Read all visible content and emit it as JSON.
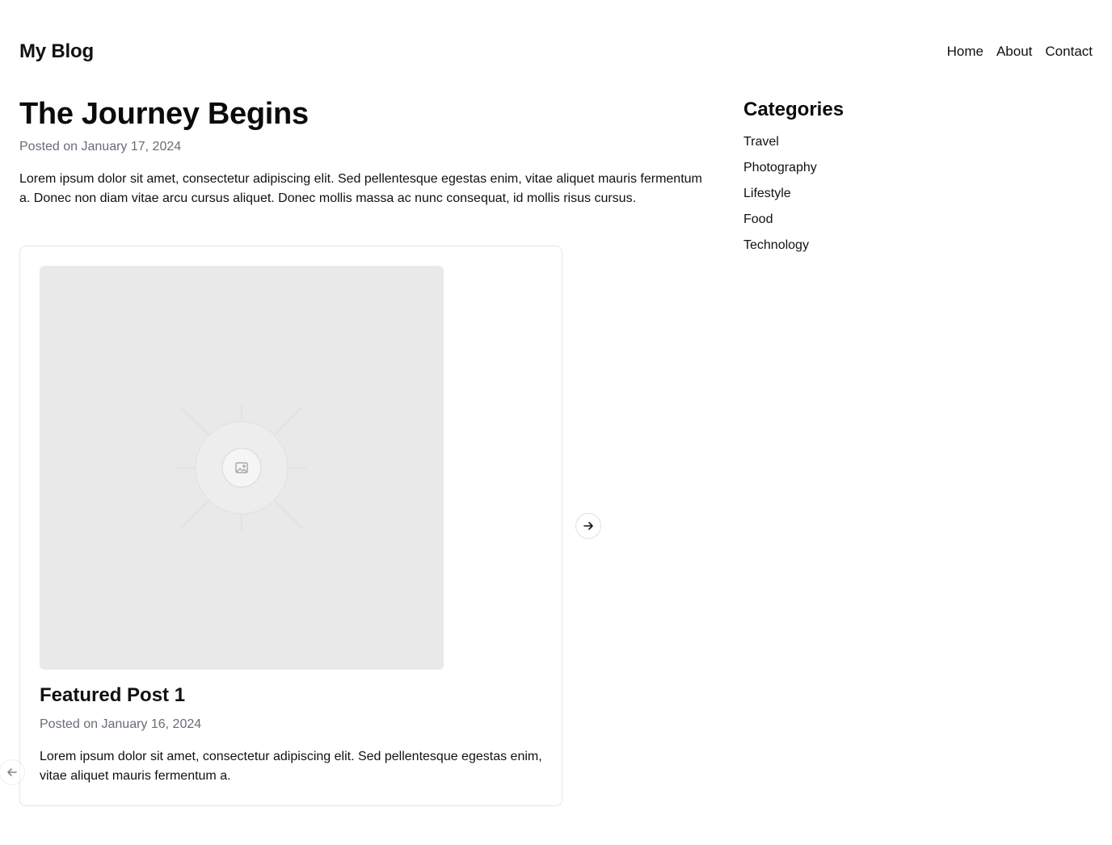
{
  "header": {
    "site_title": "My Blog",
    "nav": [
      {
        "label": "Home"
      },
      {
        "label": "About"
      },
      {
        "label": "Contact"
      }
    ]
  },
  "post": {
    "title": "The Journey Begins",
    "date": "Posted on January 17, 2024",
    "body": "Lorem ipsum dolor sit amet, consectetur adipiscing elit. Sed pellentesque egestas enim, vitae aliquet mauris fermentum a. Donec non diam vitae arcu cursus aliquet. Donec mollis massa ac nunc consequat, id mollis risus cursus."
  },
  "carousel": {
    "slide": {
      "image_icon": "image-placeholder-icon",
      "title": "Featured Post 1",
      "date": "Posted on January 16, 2024",
      "excerpt": "Lorem ipsum dolor sit amet, consectetur adipiscing elit. Sed pellentesque egestas enim, vitae aliquet mauris fermentum a."
    },
    "next_icon": "arrow-right-icon",
    "prev_icon": "arrow-left-icon"
  },
  "sidebar": {
    "title": "Categories",
    "categories": [
      {
        "label": "Travel"
      },
      {
        "label": "Photography"
      },
      {
        "label": "Lifestyle"
      },
      {
        "label": "Food"
      },
      {
        "label": "Technology"
      }
    ]
  },
  "colors": {
    "text": "#111111",
    "muted": "#6b6b78",
    "border": "#e5e5e5",
    "placeholder_bg": "#e9e9e9"
  }
}
